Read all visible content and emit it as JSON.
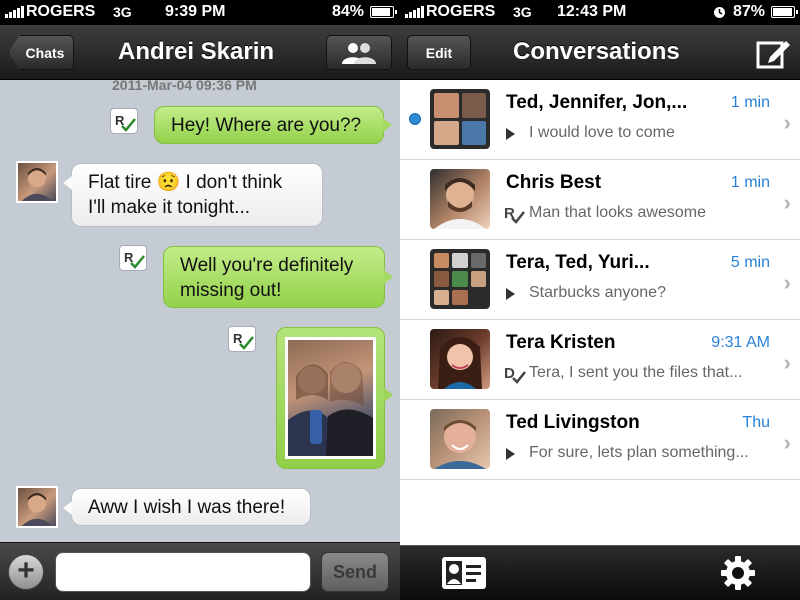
{
  "chat_screen": {
    "status": {
      "carrier": "ROGERS",
      "network": "3G",
      "time": "9:39 PM",
      "battery": "84%",
      "battery_level": 0.84
    },
    "nav": {
      "back_label": "Chats",
      "title": "Andrei Skarin"
    },
    "date_stamp": "2011-Mar-04 09:36 PM",
    "messages": [
      {
        "direction": "out",
        "lines": [
          "Hey! Where are you??"
        ],
        "receipt": "read"
      },
      {
        "direction": "in",
        "lines": [
          "Flat tire 😟  I don't think",
          "I'll make it tonight..."
        ]
      },
      {
        "direction": "out",
        "lines": [
          "Well you're definitely",
          "missing out!"
        ],
        "receipt": "read"
      },
      {
        "direction": "out",
        "type": "photo",
        "receipt": "read"
      },
      {
        "direction": "in",
        "lines": [
          "Aww I wish I was there!"
        ]
      }
    ],
    "composer": {
      "placeholder": "",
      "send_label": "Send"
    }
  },
  "conversations_screen": {
    "status": {
      "carrier": "ROGERS",
      "network": "3G",
      "time": "12:43 PM",
      "battery": "87%",
      "battery_level": 0.87
    },
    "nav": {
      "edit_label": "Edit",
      "title": "Conversations"
    },
    "rows": [
      {
        "name": "Ted, Jennifer, Jon,...",
        "time": "1 min",
        "preview": "I would love to come",
        "status_icon": "play",
        "unread": true,
        "avatar": "group-4"
      },
      {
        "name": "Chris Best",
        "time": "1 min",
        "preview": "Man that looks awesome",
        "status_icon": "read",
        "unread": false,
        "avatar": "single"
      },
      {
        "name": "Tera, Ted, Yuri...",
        "time": "5 min",
        "preview": "Starbucks anyone?",
        "status_icon": "play",
        "unread": false,
        "avatar": "group-9"
      },
      {
        "name": "Tera Kristen",
        "time": "9:31 AM",
        "preview": "Tera, I sent you the files that...",
        "status_icon": "delivered",
        "unread": false,
        "avatar": "single"
      },
      {
        "name": "Ted Livingston",
        "time": "Thu",
        "preview": "For sure, lets plan something...",
        "status_icon": "play",
        "unread": false,
        "avatar": "single"
      }
    ],
    "tabbar": {
      "left_icon": "contact-card-icon",
      "right_icon": "gear-icon"
    }
  }
}
